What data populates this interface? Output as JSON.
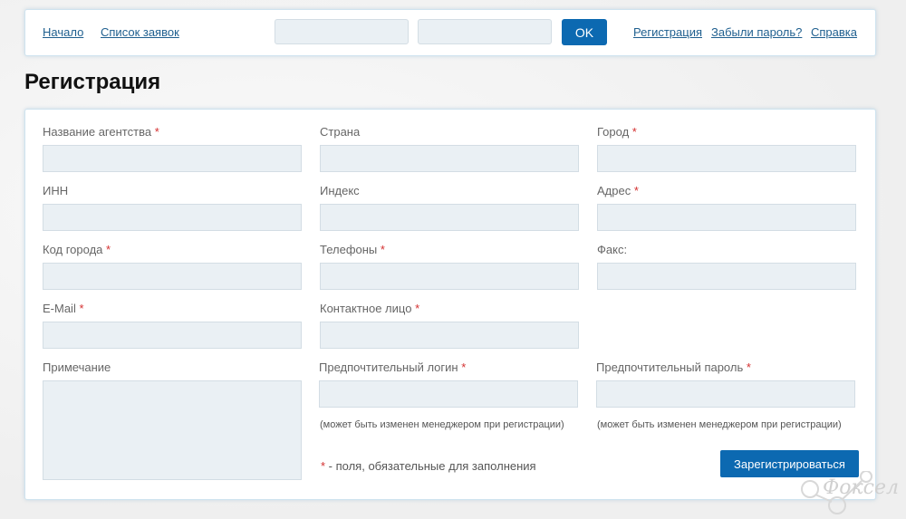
{
  "nav": {
    "home": "Начало",
    "requests": "Список заявок",
    "ok": "OK",
    "register": "Регистрация",
    "forgot": "Забыли пароль?",
    "help": "Справка"
  },
  "page": {
    "title": "Регистрация"
  },
  "form": {
    "agency_name": "Название агентства",
    "country": "Страна",
    "city": "Город",
    "inn": "ИНН",
    "index": "Индекс",
    "address": "Адрес",
    "city_code": "Код города",
    "phones": "Телефоны",
    "fax": "Факс:",
    "email": "E-Mail",
    "contact": "Контактное лицо",
    "note": "Примечание",
    "login": "Предпочтительный логин",
    "password": "Предпочтительный пароль",
    "hint": "(может быть изменен менеджером при регистрации)",
    "required_mark": "*",
    "legend_text": " -  поля, обязательные для заполнения",
    "submit": "Зарегистрироваться"
  },
  "watermark": {
    "text": "Фоксел"
  },
  "colors": {
    "accent": "#0c69b1",
    "required": "#d43030",
    "field_bg": "#eaf0f4"
  }
}
